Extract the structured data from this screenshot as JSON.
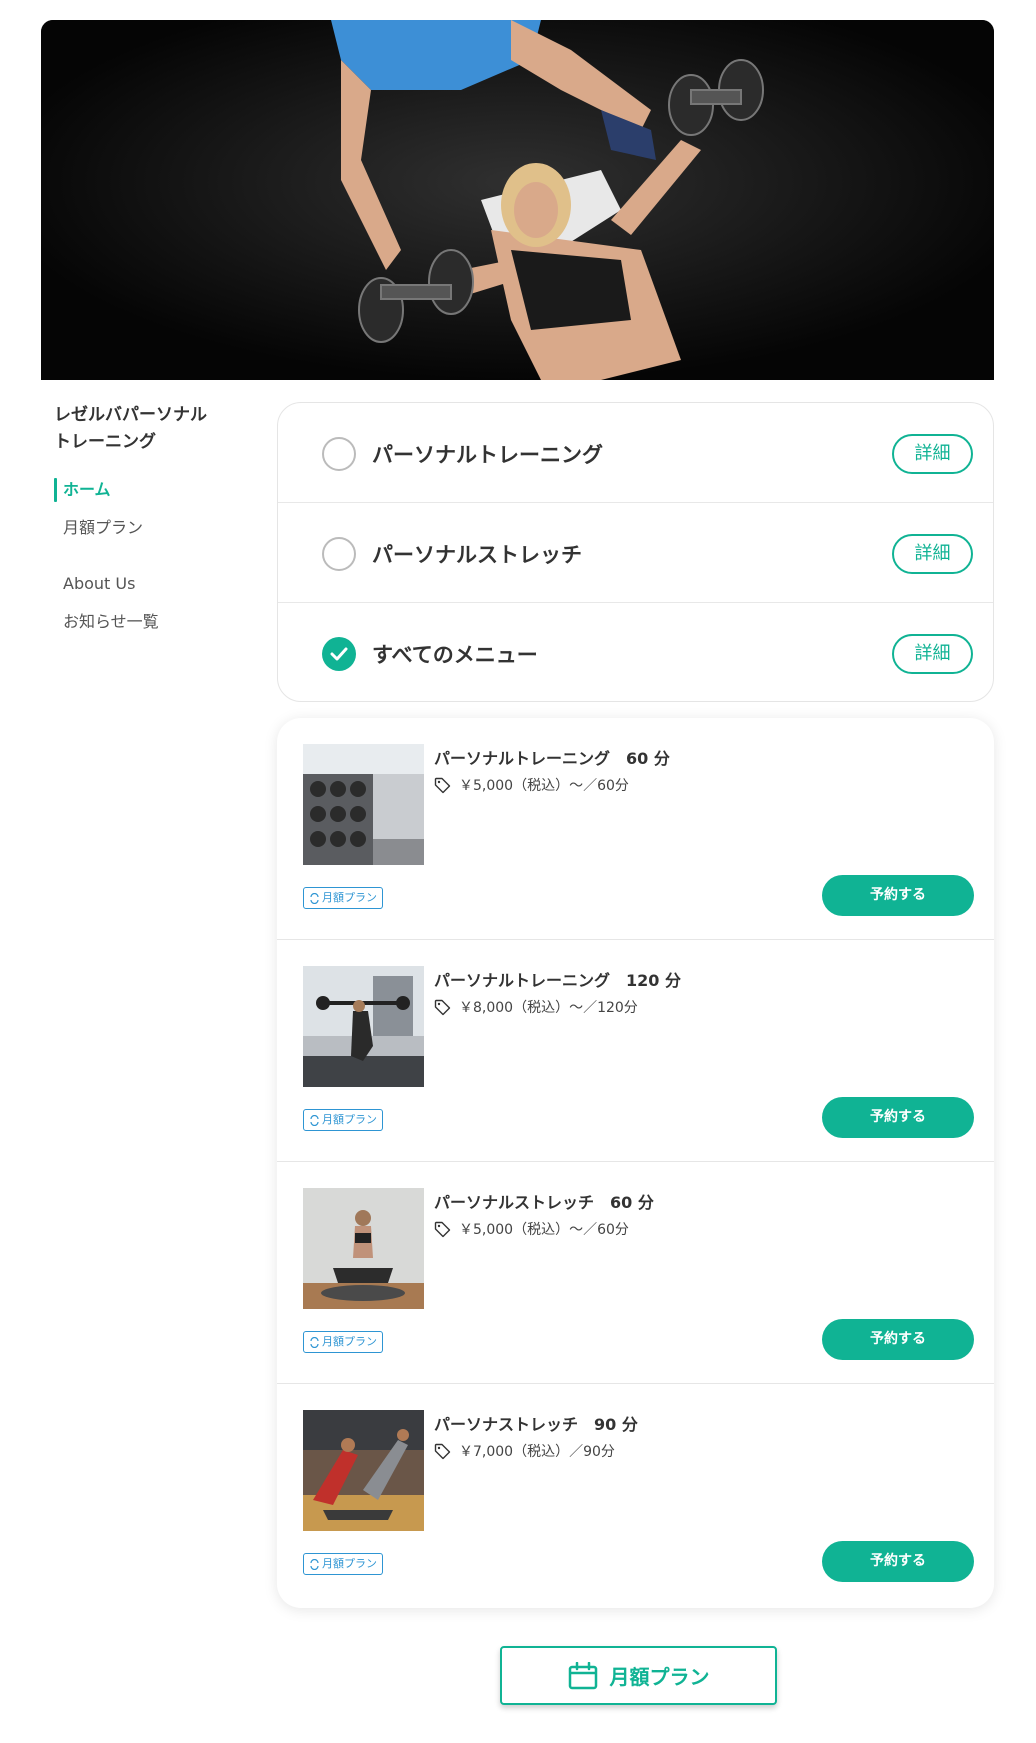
{
  "hero": {
    "image_alt": "personal training hero photo"
  },
  "sidebar": {
    "brand_line1": "レゼルバパーソナル",
    "brand_line2": "トレーニング",
    "items": [
      {
        "label": "ホーム",
        "active": true
      },
      {
        "label": "月額プラン"
      },
      {
        "label": "About Us"
      },
      {
        "label": "お知らせ一覧"
      }
    ]
  },
  "categories": [
    {
      "label": "パーソナルトレーニング",
      "checked": false,
      "detail_label": "詳細"
    },
    {
      "label": "パーソナルストレッチ",
      "checked": false,
      "detail_label": "詳細"
    },
    {
      "label": "すべてのメニュー",
      "checked": true,
      "detail_label": "詳細"
    }
  ],
  "menu_items": [
    {
      "title": "パーソナルトレーニング　60 分",
      "price": "￥5,000（税込）〜／60分",
      "badge": "月額プラン",
      "reserve_label": "予約する",
      "icon": "tag-icon"
    },
    {
      "title": "パーソナルトレーニング　120 分",
      "price": "￥8,000（税込）〜／120分",
      "badge": "月額プラン",
      "reserve_label": "予約する",
      "icon": "tag-icon"
    },
    {
      "title": "パーソナルストレッチ　60 分",
      "price": "￥5,000（税込）〜／60分",
      "badge": "月額プラン",
      "reserve_label": "予約する",
      "icon": "tag-icon"
    },
    {
      "title": "パーソナストレッチ　90 分",
      "price": "￥7,000（税込）／90分",
      "badge": "月額プラン",
      "reserve_label": "予約する",
      "icon": "tag-icon"
    }
  ],
  "monthly_button": {
    "label": "月額プラン",
    "icon": "calendar-icon"
  },
  "colors": {
    "accent": "#10b394",
    "badge": "#2e95d3",
    "text": "#333333"
  }
}
